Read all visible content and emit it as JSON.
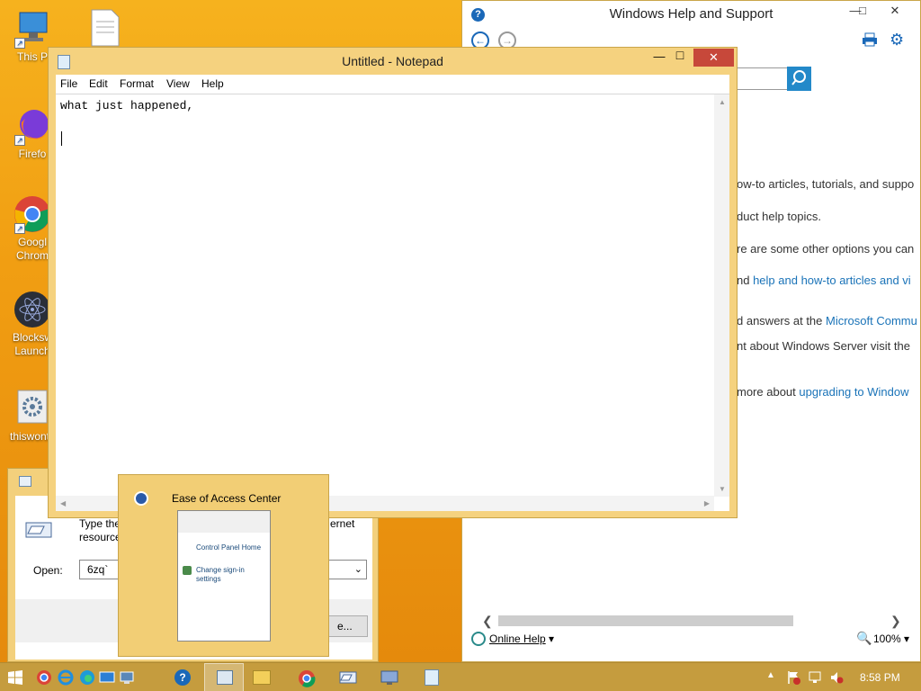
{
  "desktop": {
    "icons": [
      {
        "label": "This P"
      },
      {
        "label": "Firefo"
      },
      {
        "label": "Googl",
        "label2": "Chrom"
      },
      {
        "label": "Blocksw",
        "label2": "Launch"
      },
      {
        "label": "thiswontv"
      }
    ]
  },
  "help": {
    "title": "Windows Help and Support",
    "lines": [
      "ow-to articles, tutorials, and suppo",
      "duct help topics.",
      "re are some other options you can",
      "nd ",
      "help and how-to articles and vi",
      "d answers at the ",
      "Microsoft Commu",
      "nt about Windows Server visit the",
      " more about ",
      "upgrading to Window"
    ],
    "status_online": "Online Help",
    "zoom": "100%"
  },
  "notepad": {
    "title": "Untitled - Notepad",
    "menu": [
      "File",
      "Edit",
      "Format",
      "View",
      "Help"
    ],
    "content": "what just happened,"
  },
  "run": {
    "desc1": "Type the n",
    "desc1_end": "ernet",
    "desc2": "resource, a",
    "open_label": "Open:",
    "open_value": "6zq`",
    "browse_label": "e..."
  },
  "thumbnail": {
    "title": "Ease of Access Center",
    "preview_home": "Control Panel Home",
    "preview_link1": "Change sign-in",
    "preview_link2": "settings"
  },
  "taskbar": {
    "clock": "8:58 PM"
  }
}
